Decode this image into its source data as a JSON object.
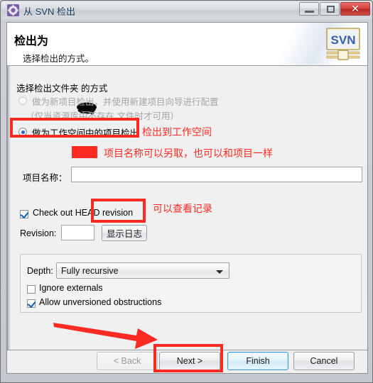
{
  "window": {
    "title": "从 SVN 检出",
    "icon": "svn-gear-icon",
    "controls": {
      "minimize": "minimize-icon",
      "maximize": "maximize-icon",
      "close": "✕"
    }
  },
  "header": {
    "title": "检出为",
    "subtitle": "选择检出的方式。",
    "logo_text": "SVN"
  },
  "form": {
    "section_label": "选择检出文件夹 的方式",
    "redaction": "black-scribble-redaction",
    "option_new_project": {
      "label": "做为新项目检出，并使用新建项目向导进行配置",
      "hint": "（仅当资源库中不存在 文件时才可用）",
      "selected": false,
      "enabled": false
    },
    "option_workspace_project": {
      "label": "做为工作空间中的项目检出",
      "selected": true,
      "enabled": true
    },
    "project_name_label": "项目名称：",
    "project_name_value": "",
    "checkout_head_label": "Check out HEAD revision",
    "checkout_head_checked": true,
    "revision_label": "Revision:",
    "revision_value": "",
    "show_log_button": "显示日志",
    "depth_label": "Depth:",
    "depth_value": "Fully recursive",
    "ignore_externals_label": "Ignore externals",
    "ignore_externals_checked": false,
    "allow_unversioned_label": "Allow unversioned obstructions",
    "allow_unversioned_checked": true
  },
  "footer": {
    "back": "< Back",
    "back_enabled": false,
    "next": "Next >",
    "finish": "Finish",
    "cancel": "Cancel"
  },
  "annotations": {
    "color": "#fb2a22",
    "workspace_note": "检出到工作空间",
    "project_name_note": "项目名称可以另取，也可以和项目一样",
    "show_log_note": "可以查看记录",
    "arrow": "red-arrow-pointing-to-next-button"
  }
}
